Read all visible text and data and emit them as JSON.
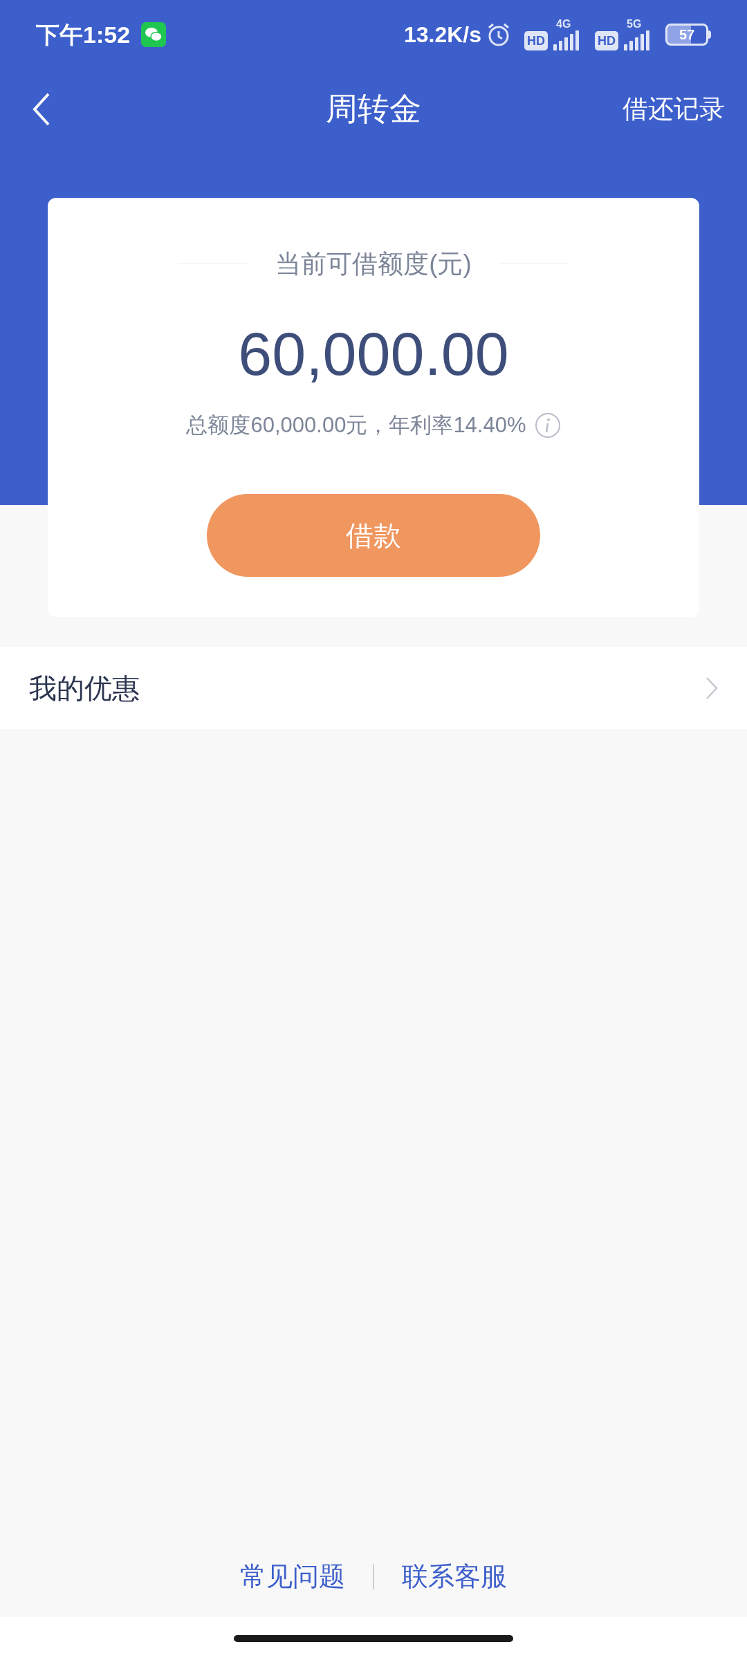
{
  "status_bar": {
    "time": "下午1:52",
    "speed": "13.2K/s",
    "sim1": {
      "hd": "HD",
      "network": "4G"
    },
    "sim2": {
      "hd": "HD",
      "network": "5G"
    },
    "battery": "57"
  },
  "nav": {
    "title": "周转金",
    "action": "借还记录"
  },
  "card": {
    "label": "当前可借额度(元)",
    "amount": "60,000.00",
    "summary": "总额度60,000.00元，年利率14.40%",
    "button": "借款"
  },
  "rows": [
    {
      "label": "我的优惠"
    }
  ],
  "footer": {
    "links": [
      "常见问题",
      "联系客服"
    ]
  }
}
